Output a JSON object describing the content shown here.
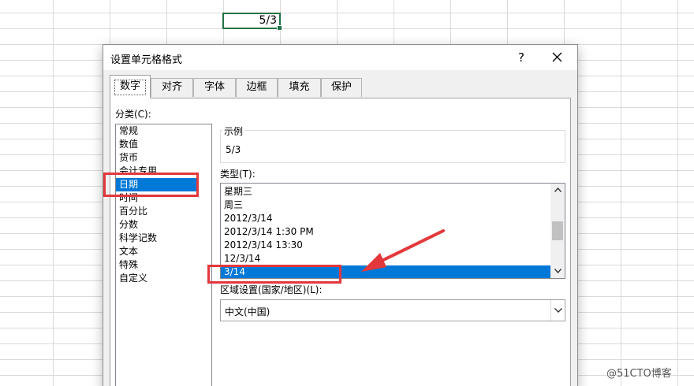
{
  "sheet": {
    "cell_value": "5/3"
  },
  "dialog": {
    "title": "设置单元格格式",
    "help_label": "?",
    "tabs": [
      "数字",
      "对齐",
      "字体",
      "边框",
      "填充",
      "保护"
    ],
    "active_tab": "数字"
  },
  "category": {
    "label": "分类(C):",
    "items": [
      "常规",
      "数值",
      "货币",
      "会计专用",
      "日期",
      "时间",
      "百分比",
      "分数",
      "科学记数",
      "文本",
      "特殊",
      "自定义"
    ],
    "selected": "日期"
  },
  "sample": {
    "label": "示例",
    "value": "5/3"
  },
  "type": {
    "label": "类型(T):",
    "items": [
      "星期三",
      "周三",
      "2012/3/14",
      "2012/3/14 1:30 PM",
      "2012/3/14 13:30",
      "12/3/14",
      "3/14"
    ],
    "selected": "3/14"
  },
  "locale": {
    "label": "区域设置(国家/地区)(L):",
    "value": "中文(中国)"
  },
  "watermark": "@51CTO博客",
  "colors": {
    "selection": "#0078d7",
    "annotation": "#e3383b",
    "cell_border": "#217346"
  }
}
